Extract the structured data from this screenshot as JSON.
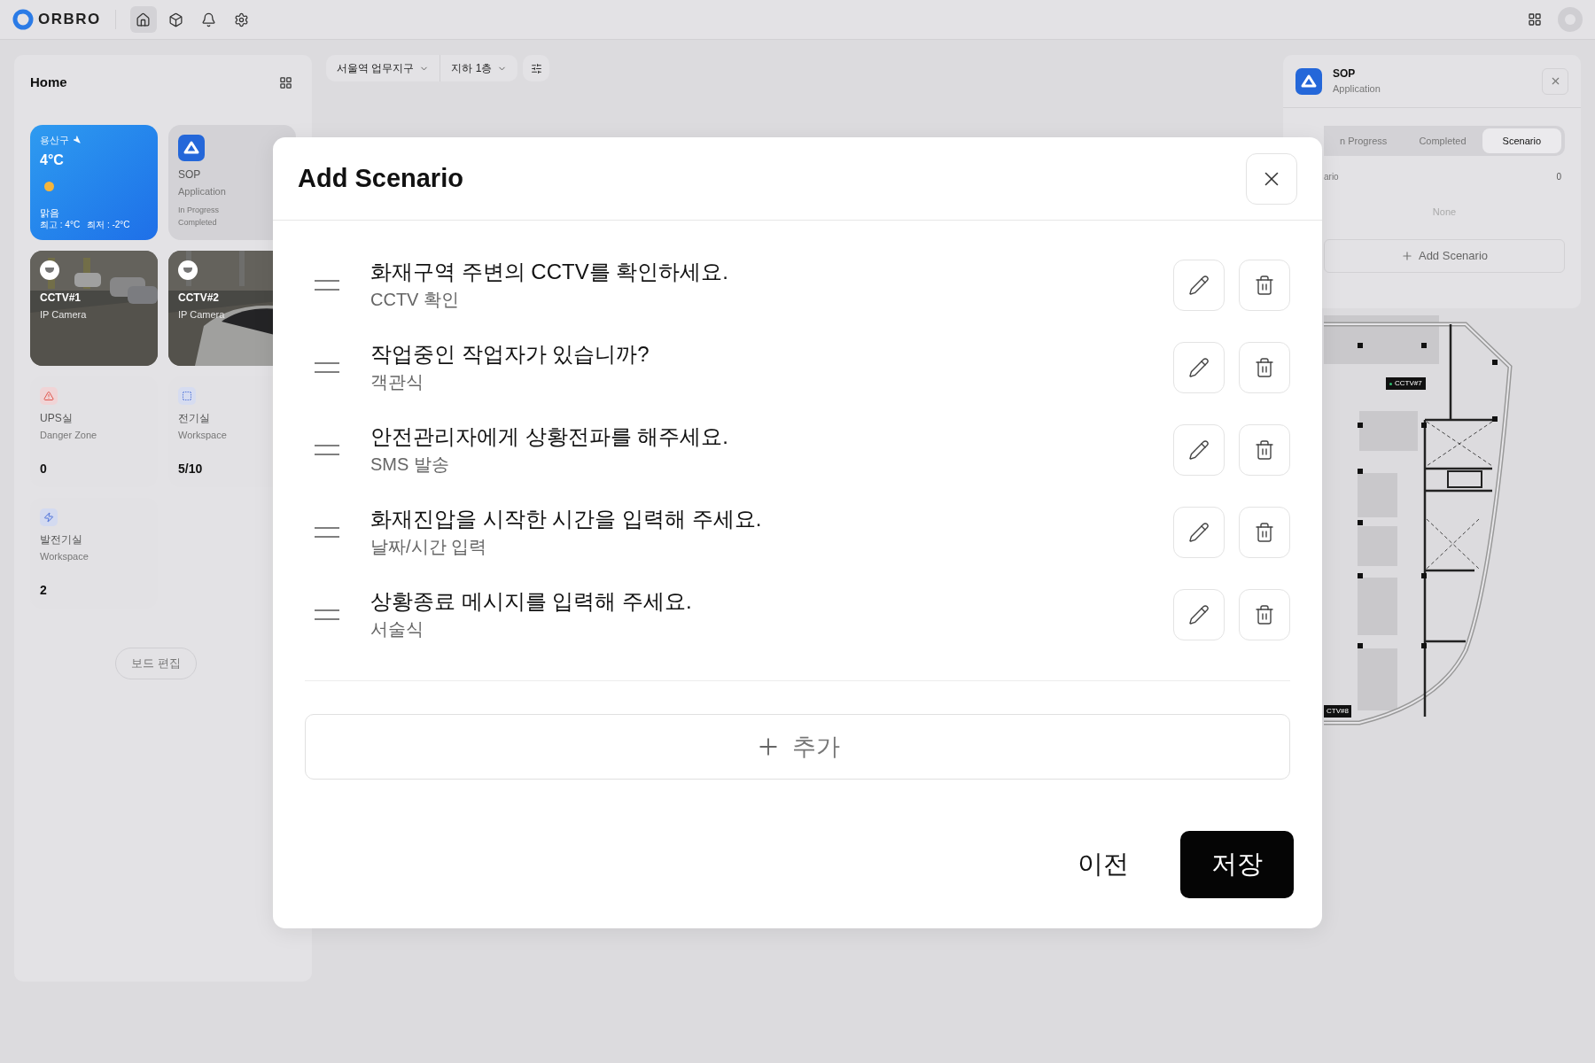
{
  "top_bar": {
    "logo": "ORBRO",
    "nav": [
      {
        "kind": "home",
        "selected": true
      },
      {
        "kind": "cube",
        "selected": false
      },
      {
        "kind": "bell",
        "selected": false
      },
      {
        "kind": "settings",
        "selected": false
      }
    ]
  },
  "home_panel": {
    "title": "Home",
    "widgets": [
      {
        "kind": "weather",
        "location": "용산구",
        "temperature": "4°C",
        "condition": "맑음",
        "high": "최고 : 4°C",
        "low": "최저 : -2°C"
      },
      {
        "kind": "app",
        "name": "SOP",
        "subtitle": "Application",
        "lines": [
          "In Progress",
          "Completed"
        ]
      },
      {
        "kind": "camera",
        "name": "CCTV#1",
        "subtitle": "IP Camera"
      },
      {
        "kind": "camera",
        "name": "CCTV#2",
        "subtitle": "IP Camera"
      },
      {
        "kind": "danger",
        "name": "UPS실",
        "subtitle": "Danger Zone",
        "value": "0"
      },
      {
        "kind": "area",
        "name": "전기실",
        "subtitle": "Workspace",
        "value": "5/10"
      },
      {
        "kind": "power",
        "name": "발전기실",
        "subtitle": "Workspace",
        "value": "2"
      }
    ],
    "edit_button": "보드 편집"
  },
  "toolbar": {
    "site": "서울역 업무지구",
    "floor": "지하 1층"
  },
  "sop_panel": {
    "name": "SOP",
    "subtitle": "Application",
    "tabs": [
      {
        "label": "n Progress",
        "selected": false
      },
      {
        "label": "Completed",
        "selected": false
      },
      {
        "label": "Scenario",
        "selected": true
      }
    ],
    "section_label": "ario",
    "count": "0",
    "empty": "None",
    "add_button": "Add Scenario"
  },
  "floor_plan": {
    "cameras": [
      "CCTV#7",
      "CTV#8"
    ]
  },
  "modal": {
    "title": "Add Scenario",
    "steps": [
      {
        "title": "화재구역 주변의 CCTV를 확인하세요.",
        "type": "CCTV 확인"
      },
      {
        "title": "작업중인 작업자가 있습니까?",
        "type": "객관식"
      },
      {
        "title": "안전관리자에게 상황전파를 해주세요.",
        "type": "SMS 발송"
      },
      {
        "title": "화재진압을 시작한 시간을 입력해 주세요.",
        "type": "날짜/시간 입력"
      },
      {
        "title": "상황종료 메시지를 입력해 주세요.",
        "type": "서술식"
      }
    ],
    "add_button": "추가",
    "back_button": "이전",
    "save_button": "저장"
  }
}
